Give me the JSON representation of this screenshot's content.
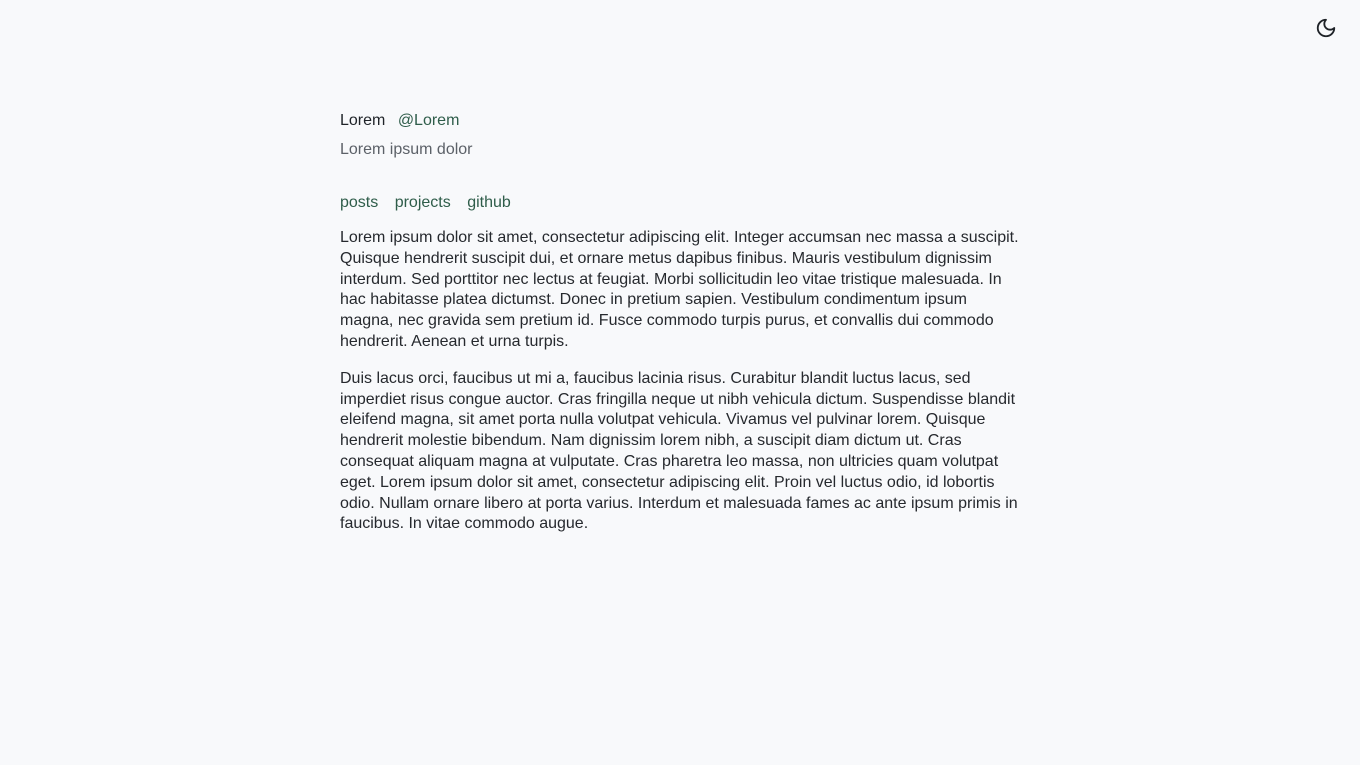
{
  "header": {
    "theme_toggle_icon": "moon-icon"
  },
  "profile": {
    "name": "Lorem",
    "handle": "@Lorem",
    "tagline": "Lorem ipsum dolor"
  },
  "nav": {
    "items": [
      {
        "label": "posts"
      },
      {
        "label": "projects"
      },
      {
        "label": "github"
      }
    ]
  },
  "content": {
    "paragraphs": [
      "Lorem ipsum dolor sit amet, consectetur adipiscing elit. Integer accumsan nec massa a suscipit. Quisque hendrerit suscipit dui, et ornare metus dapibus finibus. Mauris vestibulum dignissim interdum. Sed porttitor nec lectus at feugiat. Morbi sollicitudin leo vitae tristique malesuada. In hac habitasse platea dictumst. Donec in pretium sapien. Vestibulum condimentum ipsum magna, nec gravida sem pretium id. Fusce commodo turpis purus, et convallis dui commodo hendrerit. Aenean et urna turpis.",
      "Duis lacus orci, faucibus ut mi a, faucibus lacinia risus. Curabitur blandit luctus lacus, sed imperdiet risus congue auctor. Cras fringilla neque ut nibh vehicula dictum. Suspendisse blandit eleifend magna, sit amet porta nulla volutpat vehicula. Vivamus vel pulvinar lorem. Quisque hendrerit molestie bibendum. Nam dignissim lorem nibh, a suscipit diam dictum ut. Cras consequat aliquam magna at vulputate. Cras pharetra leo massa, non ultricies quam volutpat eget. Lorem ipsum dolor sit amet, consectetur adipiscing elit. Proin vel luctus odio, id lobortis odio. Nullam ornare libero at porta varius. Interdum et malesuada fames ac ante ipsum primis in faucibus. In vitae commodo augue."
    ]
  },
  "colors": {
    "background": "#f8f9fb",
    "link": "#2f5d4a",
    "muted_text": "#5c6168",
    "body_text": "#26292e"
  }
}
